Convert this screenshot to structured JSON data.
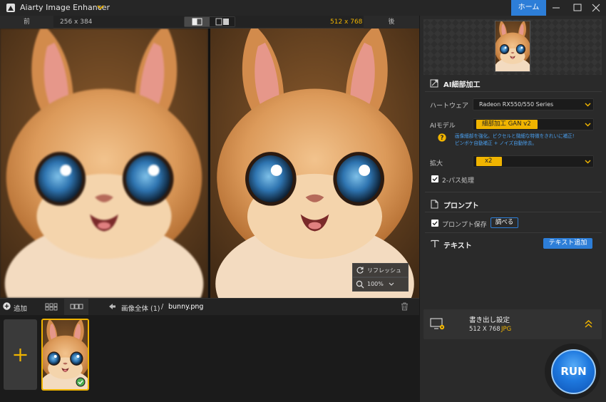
{
  "app": {
    "title": "Aiarty Image Enhancer",
    "home_label": "ホーム",
    "accent_color": "#2d7ed8",
    "highlight_color": "#f0b400"
  },
  "compare": {
    "before_label": "前",
    "before_size": "256 x 384",
    "after_label": "後",
    "after_size": "512 x 768",
    "refresh_label": "リフレッシュ",
    "zoom_value": "100%"
  },
  "bottom_bar": {
    "add_label": "追加",
    "breadcrumb_root": "画像全体 (1)",
    "breadcrumb_sep": "/",
    "file_name": "bunny.png"
  },
  "ai_detail": {
    "title": "AI細部加工",
    "hardware_label": "ハートウェア",
    "hardware_value": "Radeon RX550/550 Series",
    "model_label": "AIモデル",
    "model_value": "細部加工 GAN v2",
    "model_desc_line1": "画像細部を強化。ピクセルと微細な特徴をきれいに補正!",
    "model_desc_line2": "ピンボケ自動補正 + ノイズ自動除去。",
    "scale_label": "拡大",
    "scale_value": "x2",
    "twopass_label": "2-パス処理",
    "twopass_checked": true
  },
  "prompt": {
    "title": "プロンプト",
    "save_label": "プロンプト保存",
    "save_checked": true,
    "lookup_label": "調べる"
  },
  "text_section": {
    "title": "テキスト",
    "add_button_label": "テキスト追加"
  },
  "export": {
    "title": "書き出し設定",
    "size": "512 X 768",
    "format": "JPG"
  },
  "run_label": "RUN"
}
